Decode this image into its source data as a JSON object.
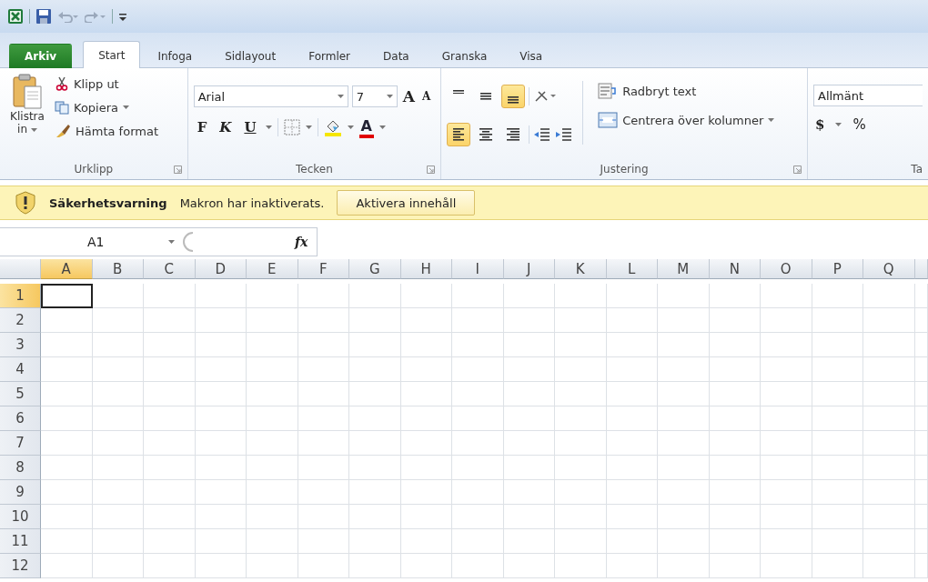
{
  "tabs": [
    {
      "label": "Arkiv",
      "kind": "file",
      "selected": false
    },
    {
      "label": "Start",
      "kind": "tab",
      "selected": true
    },
    {
      "label": "Infoga",
      "kind": "tab",
      "selected": false
    },
    {
      "label": "Sidlayout",
      "kind": "tab",
      "selected": false
    },
    {
      "label": "Formler",
      "kind": "tab",
      "selected": false
    },
    {
      "label": "Data",
      "kind": "tab",
      "selected": false
    },
    {
      "label": "Granska",
      "kind": "tab",
      "selected": false
    },
    {
      "label": "Visa",
      "kind": "tab",
      "selected": false
    }
  ],
  "clipboard": {
    "paste_line1": "Klistra",
    "paste_line2": "in",
    "items": [
      {
        "kind": "cut",
        "label": "Klipp ut",
        "dropdown": false
      },
      {
        "kind": "copy",
        "label": "Kopiera",
        "dropdown": true
      },
      {
        "kind": "format",
        "label": "Hämta format",
        "dropdown": false
      }
    ],
    "group_label": "Urklipp"
  },
  "font": {
    "name": "Arial",
    "size": "7",
    "grow": "A",
    "shrink": "A",
    "style_buttons": [
      {
        "kind": "bold",
        "label": "F"
      },
      {
        "kind": "italic",
        "label": "K"
      },
      {
        "kind": "underline",
        "label": "U"
      }
    ],
    "font_color": "A",
    "group_label": "Tecken"
  },
  "alignment": {
    "vertical": [
      {
        "kind": "top",
        "selected": false
      },
      {
        "kind": "middle",
        "selected": false
      },
      {
        "kind": "bottom",
        "selected": true
      }
    ],
    "horizontal": [
      {
        "kind": "left",
        "selected": true
      },
      {
        "kind": "center",
        "selected": false
      },
      {
        "kind": "right",
        "selected": false
      }
    ],
    "wrap": "Radbryt text",
    "merge": "Centrera över kolumner",
    "group_label": "Justering"
  },
  "number": {
    "format": "Allmänt",
    "currency": "$",
    "percent": "%",
    "group_label": "Ta"
  },
  "message_bar": {
    "title": "Säkerhetsvarning",
    "text": "Makron har inaktiverats.",
    "button": "Aktivera innehåll"
  },
  "formula_bar": {
    "name_box": "A1",
    "fx": "fx"
  },
  "columns": [
    {
      "label": "A",
      "selected": true
    },
    {
      "label": "B",
      "selected": false
    },
    {
      "label": "C",
      "selected": false
    },
    {
      "label": "D",
      "selected": false
    },
    {
      "label": "E",
      "selected": false
    },
    {
      "label": "F",
      "selected": false
    },
    {
      "label": "G",
      "selected": false
    },
    {
      "label": "H",
      "selected": false
    },
    {
      "label": "I",
      "selected": false
    },
    {
      "label": "J",
      "selected": false
    },
    {
      "label": "K",
      "selected": false
    },
    {
      "label": "L",
      "selected": false
    },
    {
      "label": "M",
      "selected": false
    },
    {
      "label": "N",
      "selected": false
    },
    {
      "label": "O",
      "selected": false
    },
    {
      "label": "P",
      "selected": false
    },
    {
      "label": "Q",
      "selected": false
    }
  ],
  "rows": [
    {
      "label": "1",
      "selected": true
    },
    {
      "label": "2",
      "selected": false
    },
    {
      "label": "3",
      "selected": false
    },
    {
      "label": "4",
      "selected": false
    },
    {
      "label": "5",
      "selected": false
    },
    {
      "label": "6",
      "selected": false
    },
    {
      "label": "7",
      "selected": false
    },
    {
      "label": "8",
      "selected": false
    },
    {
      "label": "9",
      "selected": false
    },
    {
      "label": "10",
      "selected": false
    },
    {
      "label": "11",
      "selected": false
    },
    {
      "label": "12",
      "selected": false
    }
  ]
}
